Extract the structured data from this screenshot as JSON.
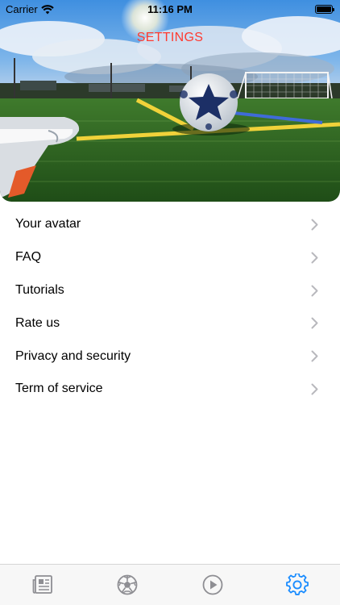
{
  "status_bar": {
    "carrier": "Carrier",
    "time": "11:16 PM"
  },
  "header": {
    "title": "SETTINGS"
  },
  "menu": {
    "items": [
      {
        "label": "Your avatar",
        "icon": "chevron-right-icon"
      },
      {
        "label": "FAQ",
        "icon": "chevron-right-icon"
      },
      {
        "label": "Tutorials",
        "icon": "chevron-right-icon"
      },
      {
        "label": "Rate us",
        "icon": "chevron-right-icon"
      },
      {
        "label": "Privacy and security",
        "icon": "chevron-right-icon"
      },
      {
        "label": "Term of service",
        "icon": "chevron-right-icon"
      }
    ]
  },
  "tab_bar": {
    "tabs": [
      {
        "icon": "news-icon",
        "active": false
      },
      {
        "icon": "soccer-ball-icon",
        "active": false
      },
      {
        "icon": "play-icon",
        "active": false
      },
      {
        "icon": "gear-icon",
        "active": true
      }
    ]
  },
  "colors": {
    "title": "#ff3b30",
    "active_tab": "#1a8cff",
    "inactive_tab": "#8e8e93",
    "chevron": "#b8b8bd"
  }
}
